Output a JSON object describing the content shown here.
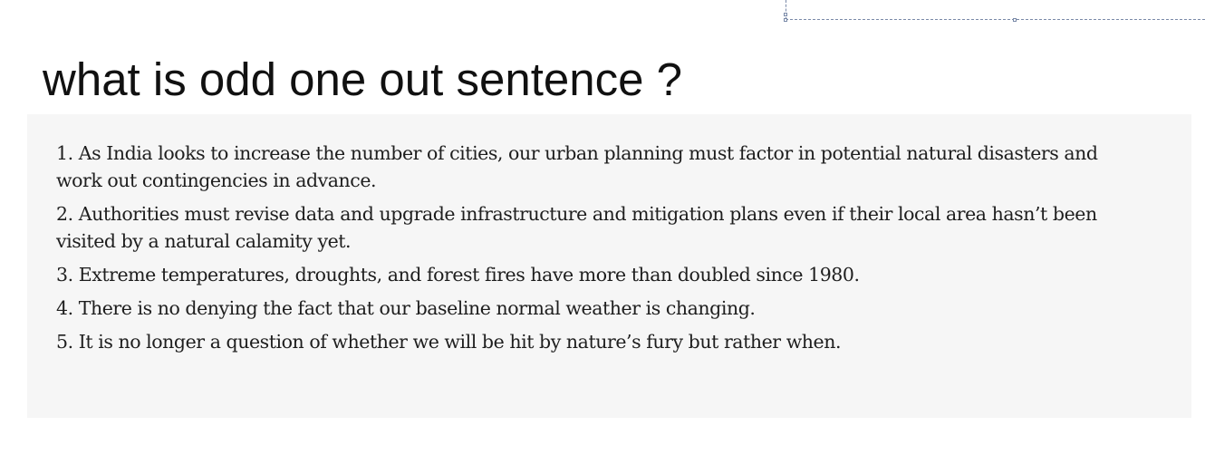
{
  "question": {
    "title": "what is odd one out sentence ?"
  },
  "passage": {
    "sentences": [
      "1. As India looks to increase the number of cities, our urban planning must factor in potential natural disasters and work out contingencies in advance.",
      "2. Authorities must revise data and upgrade infrastructure and mitigation plans even if their local area hasn’t been visited by a natural calamity yet.",
      "3. Extreme temperatures, droughts, and forest fires have more than doubled since 1980.",
      "4. There is no denying the fact that our baseline normal weather is changing.",
      "5. It is no longer a question of whether we will be hit by nature’s fury but rather when."
    ]
  },
  "colors": {
    "background": "#ffffff",
    "panel": "#f6f6f6",
    "text": "#1e1e1e",
    "selection_border": "#7a8aa8"
  }
}
